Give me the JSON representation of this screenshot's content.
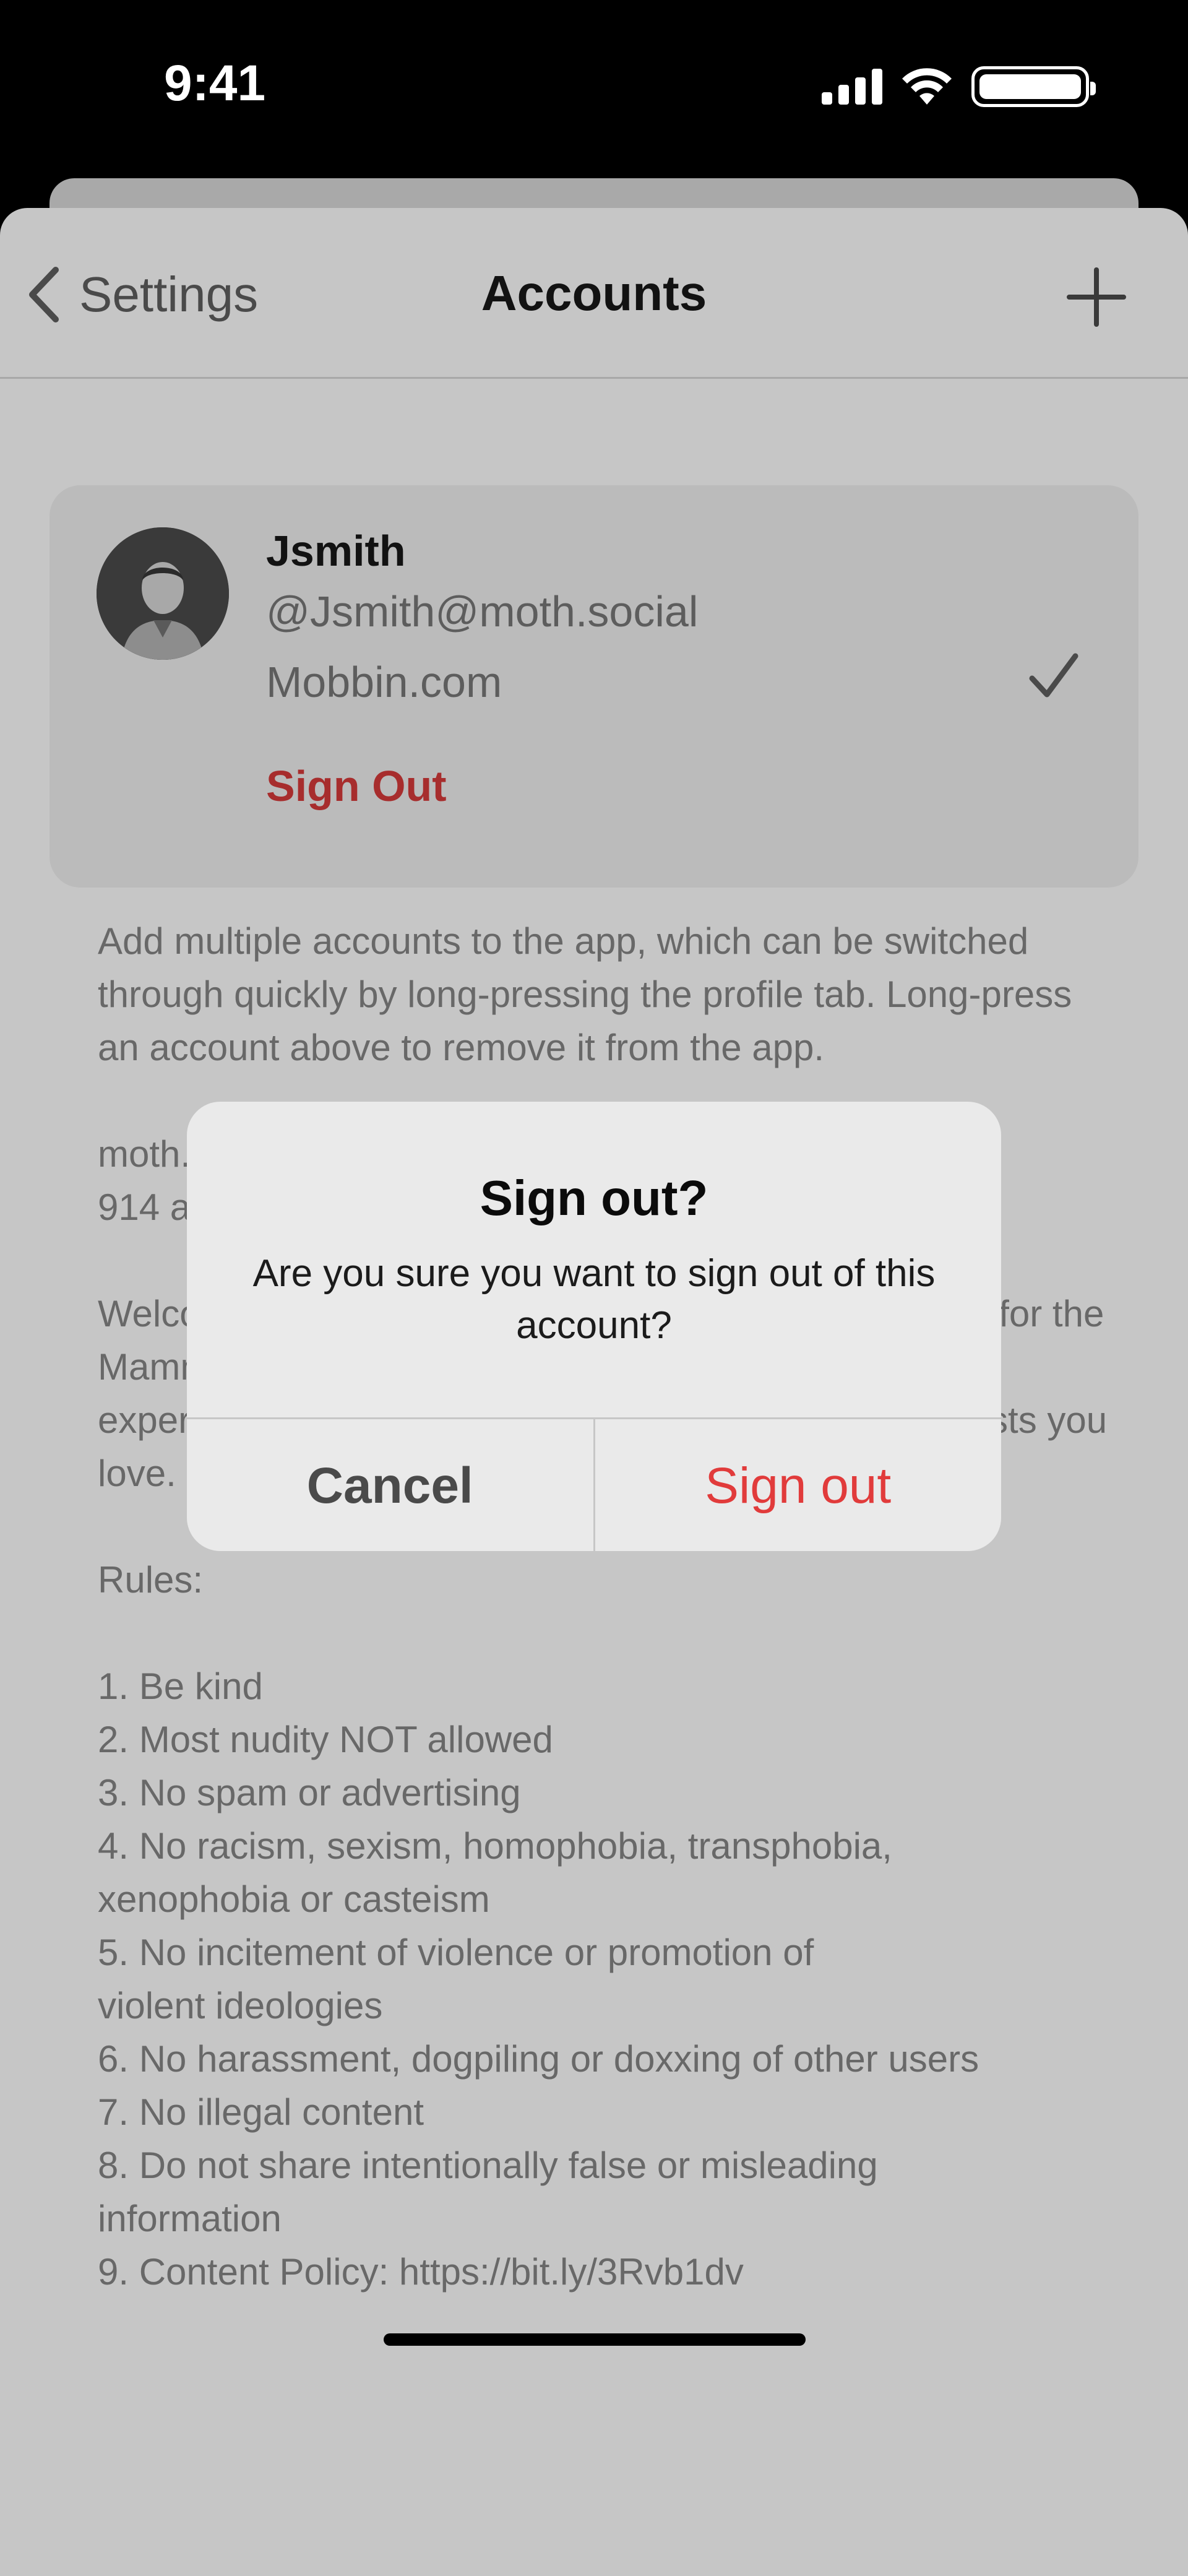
{
  "status_bar": {
    "time": "9:41",
    "icons": [
      "signal-icon",
      "wifi-icon",
      "battery-icon"
    ]
  },
  "nav": {
    "back_label": "Settings",
    "title": "Accounts",
    "add_icon": "plus-icon"
  },
  "account": {
    "name": "Jsmith",
    "handle": "@Jsmith@moth.social",
    "server": "Mobbin.com",
    "sign_out_label": "Sign Out",
    "selected": true
  },
  "info_text": "Add multiple accounts to the app, which can be switched through quickly by long-pressing the profile tab. Long-press an account above to remove it from the app.\n\nmoth.social\n914 accounts\n\nWelcome to moth.social, the flagship Mastodon server for the Mammoth app. We're also building the best Mastodon experience and the best way to find the people and posts you love.\n\nRules:\n\n1. Be kind\n2. Most nudity NOT allowed\n3. No spam or advertising\n4. No racism, sexism, homophobia, transphobia,\nxenophobia or casteism\n5. No incitement of violence or promotion of\nviolent ideologies\n6. No harassment, dogpiling or doxxing of other users\n7. No illegal content\n8. Do not share intentionally false or misleading\ninformation\n9. Content Policy: https://bit.ly/3Rvb1dv",
  "alert": {
    "title": "Sign out?",
    "message": "Are you sure you want to sign out of this account?",
    "cancel_label": "Cancel",
    "confirm_label": "Sign out"
  },
  "colors": {
    "destructive": "#e13b3b",
    "sign_out_link": "#a72d2d",
    "dim_background": "#c6c6c6"
  }
}
